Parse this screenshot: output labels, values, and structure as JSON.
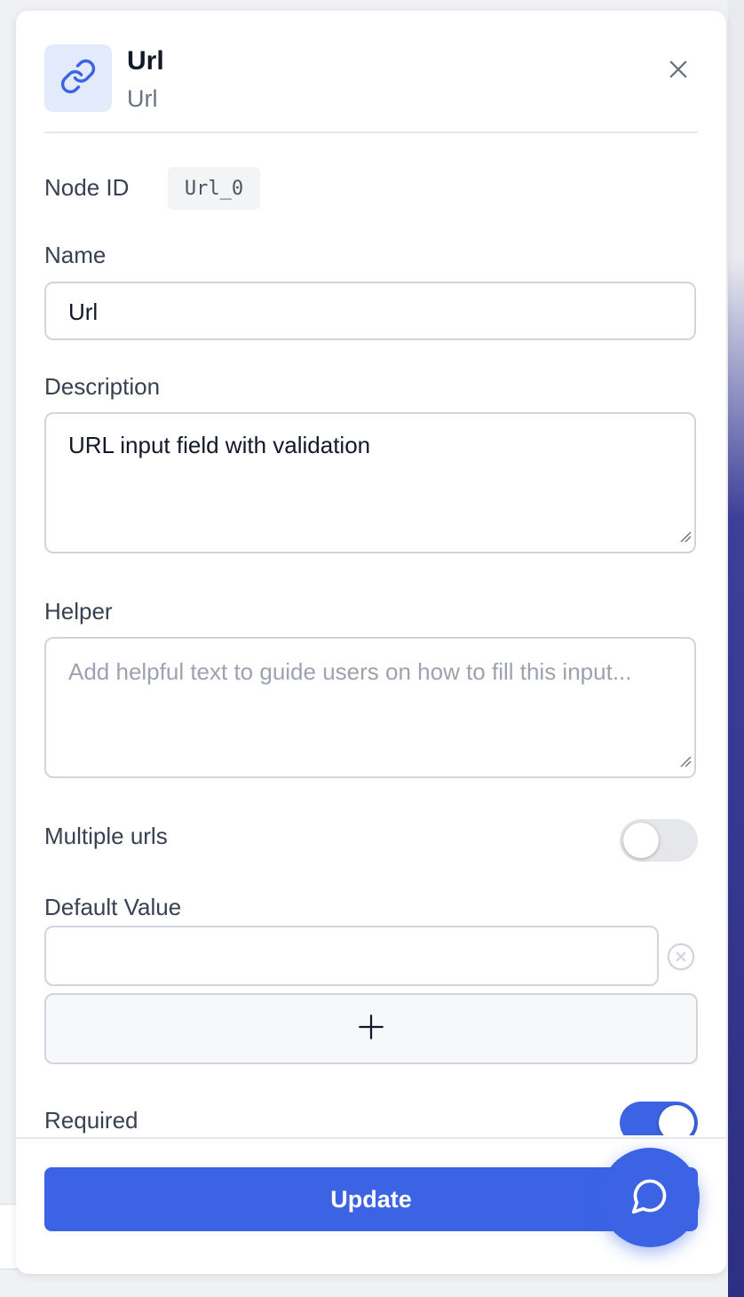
{
  "header": {
    "title": "Url",
    "subtitle": "Url",
    "icon": "link-icon"
  },
  "node_id": {
    "label": "Node ID",
    "value": "Url_0"
  },
  "name": {
    "label": "Name",
    "value": "Url"
  },
  "description": {
    "label": "Description",
    "value": "URL input field with validation"
  },
  "helper": {
    "label": "Helper",
    "placeholder": "Add helpful text to guide users on how to fill this input..."
  },
  "multiple_urls": {
    "label": "Multiple urls",
    "enabled": false
  },
  "default_value": {
    "label": "Default Value",
    "value": ""
  },
  "required": {
    "label": "Required",
    "enabled": true
  },
  "footer": {
    "update_label": "Update"
  },
  "colors": {
    "accent": "#3b63e4",
    "icon_bg": "#e3eafb",
    "toggle_off": "#e5e7eb"
  }
}
